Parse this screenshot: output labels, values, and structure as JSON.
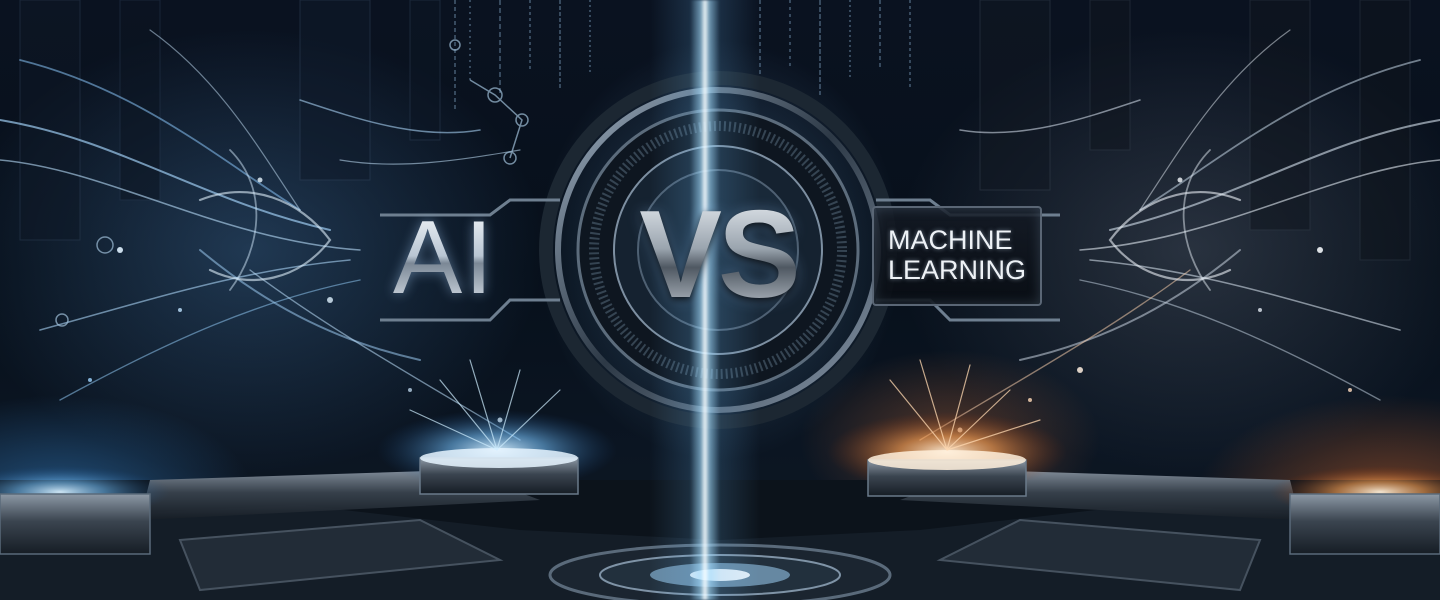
{
  "scene": {
    "left_title": "AI",
    "center_title": "VS",
    "right_title_line1": "MACHINE",
    "right_title_line2": "LEARNING"
  },
  "colors": {
    "left_accent": "#5aa8ec",
    "right_accent": "#e8782e",
    "metal": "#b9c6d3",
    "background": "#07101b"
  }
}
